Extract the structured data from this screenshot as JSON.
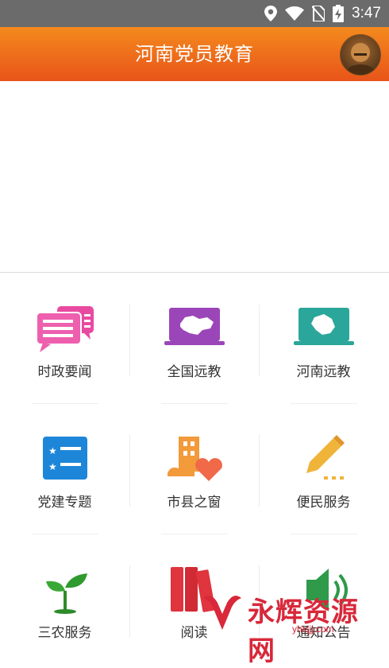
{
  "status_bar": {
    "time": "3:47"
  },
  "header": {
    "title": "河南党员教育"
  },
  "menu": [
    {
      "label": "时政要闻",
      "icon": "news-chat-icon"
    },
    {
      "label": "全国远教",
      "icon": "china-map-laptop-icon"
    },
    {
      "label": "河南远教",
      "icon": "henan-map-laptop-icon"
    },
    {
      "label": "党建专题",
      "icon": "star-list-icon"
    },
    {
      "label": "市县之窗",
      "icon": "building-heart-icon"
    },
    {
      "label": "便民服务",
      "icon": "pencil-icon"
    },
    {
      "label": "三农服务",
      "icon": "sprout-icon"
    },
    {
      "label": "阅读",
      "icon": "books-icon"
    },
    {
      "label": "通知公告",
      "icon": "speaker-icon"
    }
  ],
  "watermark": {
    "text": "永辉资源网",
    "url": "yhkjjj.com"
  }
}
